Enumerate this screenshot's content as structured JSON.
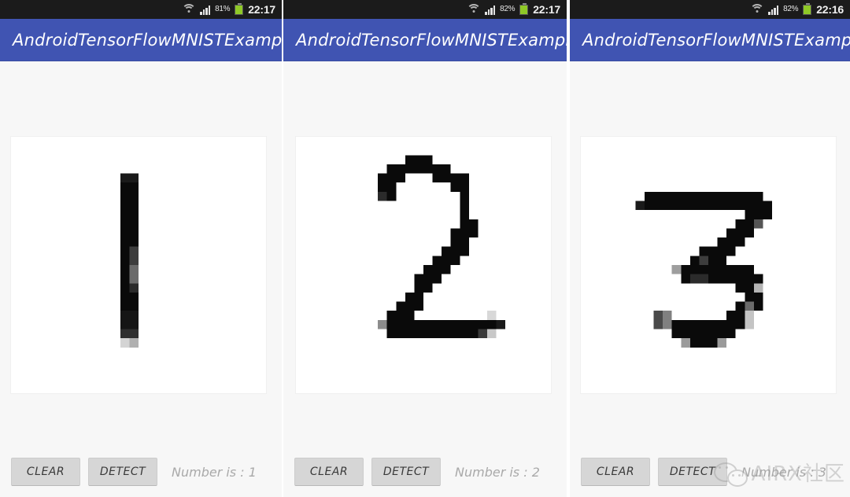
{
  "app": {
    "title": "AndroidTensorFlowMNISTExample",
    "accent_color": "#4054b2",
    "statusbar_color": "#1b1b1b",
    "background_color": "#f7f7f7",
    "button_color": "#d6d6d6",
    "battery_color": "#8fc927"
  },
  "buttons": {
    "clear_label": "CLEAR",
    "detect_label": "DETECT"
  },
  "icons": {
    "wifi": "wifi-icon",
    "signal": "signal-bars-icon",
    "battery": "battery-icon",
    "watermark_logo": "wechat-logo-icon"
  },
  "watermark": {
    "text": "AIRX社区"
  },
  "screens": [
    {
      "status": {
        "battery_percent": "81%",
        "clock": "22:17"
      },
      "title": "AndroidTensorFlowMNISTExample",
      "canvas": {
        "drawn_digit": "1",
        "description": "handwritten-digit-1"
      },
      "clear_label": "CLEAR",
      "detect_label": "DETECT",
      "result": "Number is : 1"
    },
    {
      "status": {
        "battery_percent": "82%",
        "clock": "22:17"
      },
      "title": "AndroidTensorFlowMNISTExample",
      "canvas": {
        "drawn_digit": "2",
        "description": "handwritten-digit-2"
      },
      "clear_label": "CLEAR",
      "detect_label": "DETECT",
      "result": "Number is : 2"
    },
    {
      "status": {
        "battery_percent": "82%",
        "clock": "22:16"
      },
      "title": "AndroidTensorFlowMNISTExample",
      "canvas": {
        "drawn_digit": "3",
        "description": "handwritten-digit-3"
      },
      "clear_label": "CLEAR",
      "detect_label": "DETECT",
      "result": "Number is : 3"
    }
  ]
}
